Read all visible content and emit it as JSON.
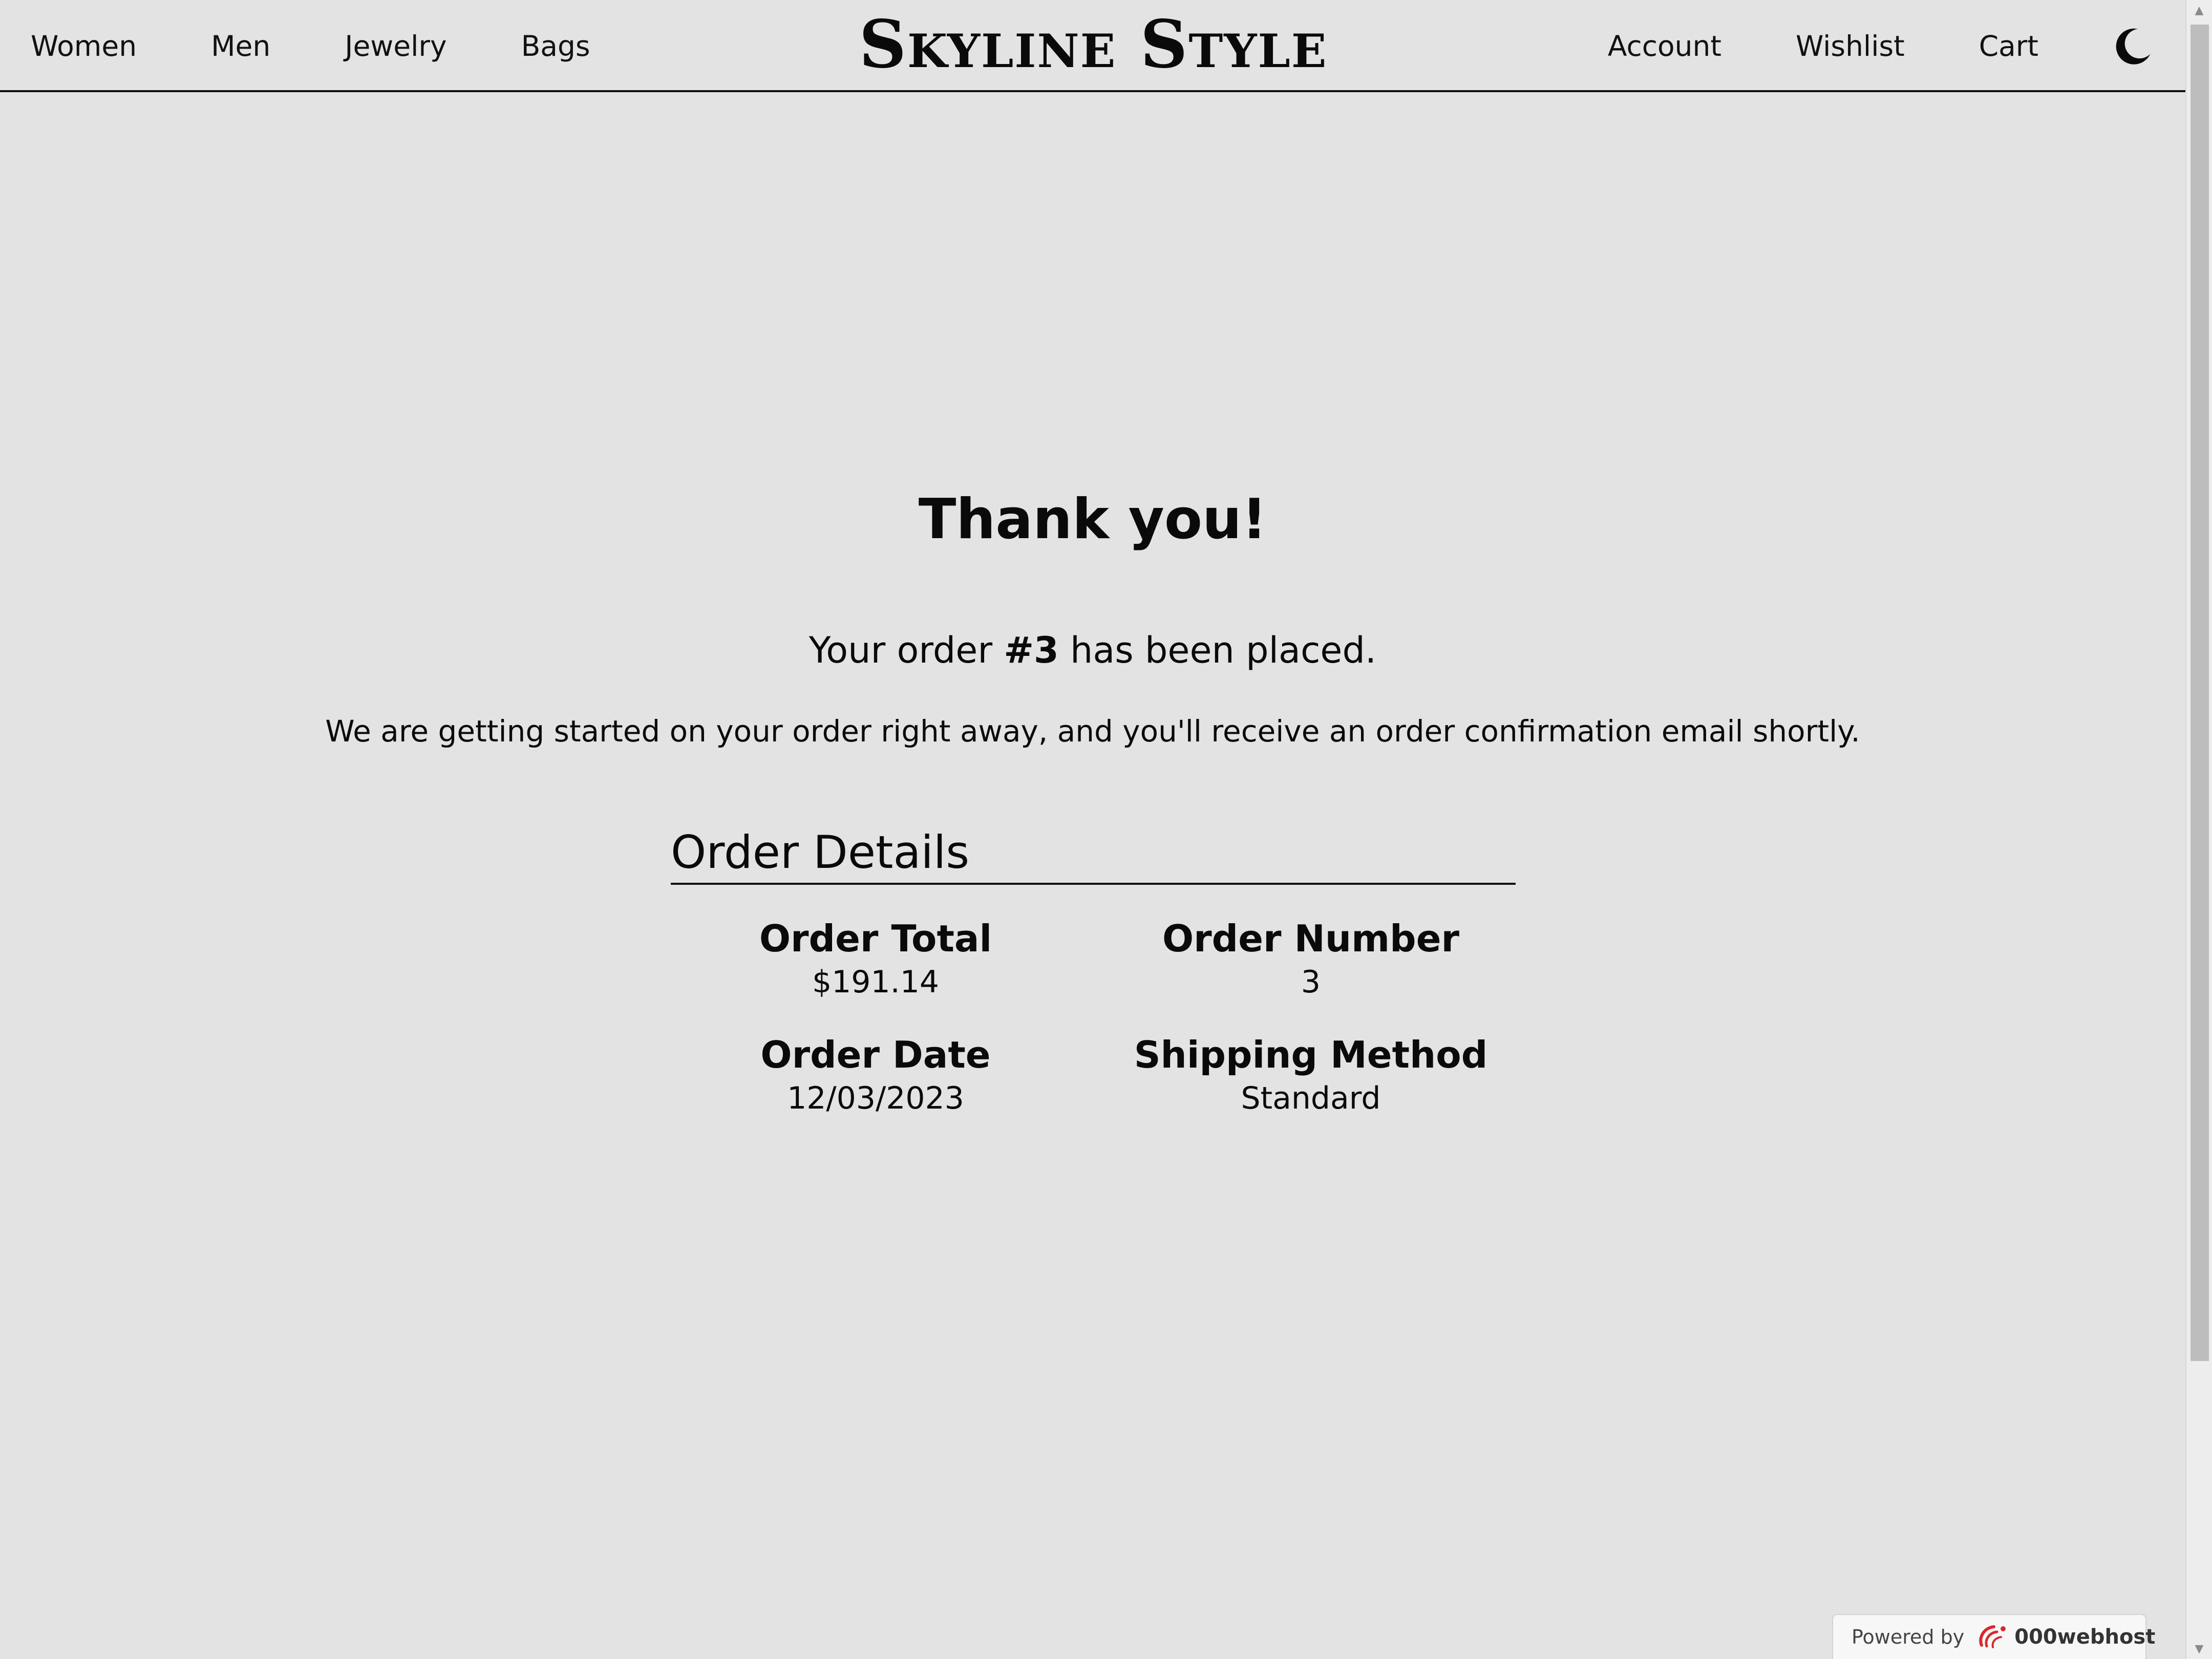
{
  "header": {
    "nav_left": [
      "Women",
      "Men",
      "Jewelry",
      "Bags"
    ],
    "brand": "Skyline Style",
    "nav_right": [
      "Account",
      "Wishlist",
      "Cart"
    ],
    "theme_toggle_icon": "moon-icon"
  },
  "main": {
    "heading": "Thank you!",
    "order_prefix": "Your order ",
    "order_number": "#3",
    "order_suffix": " has been placed.",
    "subtext": "We are getting started on your order right away, and you'll receive an order confirmation email shortly.",
    "details": {
      "title": "Order Details",
      "fields": [
        {
          "label": "Order Total",
          "value": "$191.14"
        },
        {
          "label": "Order Number",
          "value": "3"
        },
        {
          "label": "Order Date",
          "value": "12/03/2023"
        },
        {
          "label": "Shipping Method",
          "value": "Standard"
        }
      ]
    }
  },
  "footer_badge": {
    "powered_by": "Powered by",
    "host": "000webhost",
    "logo_icon": "000webhost-logo-icon"
  },
  "colors": {
    "background": "#e3e3e3",
    "text": "#0a0a0a",
    "badge_logo": "#d9282f"
  }
}
